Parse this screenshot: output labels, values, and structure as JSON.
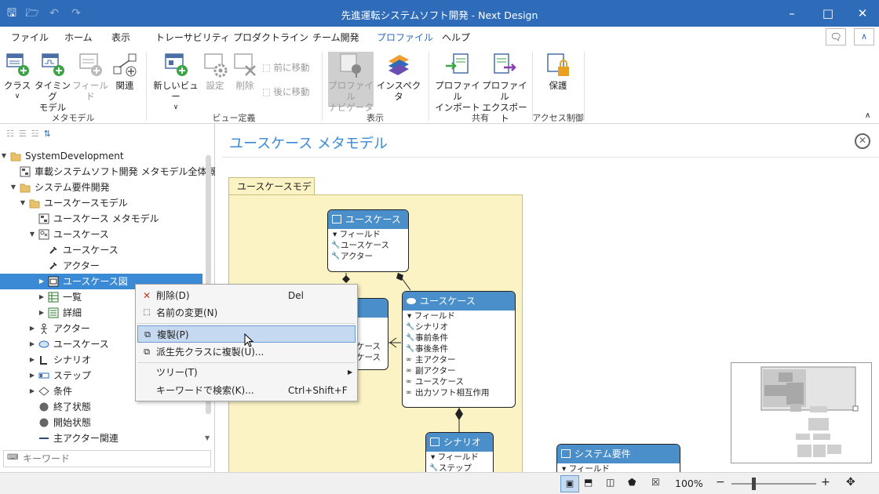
{
  "window": {
    "title": "先進運転システムソフト開発 - Next Design"
  },
  "menu": [
    "ファイル",
    "ホーム",
    "表示",
    "トレーサビリティ",
    "プロダクトライン",
    "チーム開発",
    "プロファイル",
    "ヘルプ"
  ],
  "ribbon": {
    "metamodel": {
      "class": "クラス",
      "timing": "タイミング",
      "timing2": "モデル",
      "field": "フィールド",
      "relation": "関連",
      "group": "メタモデル"
    },
    "viewdef": {
      "newview": "新しいビュー",
      "settings": "設定",
      "delete": "削除",
      "moveup": "前に移動",
      "movedown": "後に移動",
      "group": "ビュー定義"
    },
    "display": {
      "navigator": "プロファイル",
      "navigator2": "ナビゲータ",
      "inspector": "インスペクタ",
      "group": "表示"
    },
    "share": {
      "import": "プロファイル",
      "import2": "インポート",
      "export": "プロファイル",
      "export2": "エクスポート",
      "group": "共有"
    },
    "access": {
      "protect": "保護",
      "group": "アクセス制御"
    }
  },
  "tree": [
    {
      "label": "SystemDevelopment"
    },
    {
      "label": "車載システムソフト開発 メタモデル全体概要"
    },
    {
      "label": "システム要件開発"
    },
    {
      "label": "ユースケースモデル"
    },
    {
      "label": "ユースケース メタモデル"
    },
    {
      "label": "ユースケース"
    },
    {
      "label": "ユースケース"
    },
    {
      "label": "アクター"
    },
    {
      "label": "ユースケース図"
    },
    {
      "label": "一覧"
    },
    {
      "label": "詳細"
    },
    {
      "label": "アクター"
    },
    {
      "label": "ユースケース"
    },
    {
      "label": "シナリオ"
    },
    {
      "label": "ステップ"
    },
    {
      "label": "条件"
    },
    {
      "label": "終了状態"
    },
    {
      "label": "開始状態"
    },
    {
      "label": "主アクター関連"
    }
  ],
  "search": {
    "placeholder": "キーワード"
  },
  "editor": {
    "title": "ユースケース メタモデル",
    "package": "ユースケースモデル"
  },
  "nodes": {
    "usecase_top": {
      "title": "ユースケース",
      "field": "フィールド",
      "attrs": [
        "ユースケース",
        "アクター"
      ]
    },
    "usecase_main": {
      "title": "ユースケース",
      "field": "フィールド",
      "attrs": [
        "シナリオ",
        "事前条件",
        "事後条件",
        "主アクター",
        "副アクター",
        "ユースケース",
        "出力ソフト相互作用"
      ]
    },
    "partial": {
      "a1": "ケース",
      "a2": "ケース"
    },
    "scenario": {
      "title": "シナリオ",
      "field": "フィールド",
      "attr": "ステップ"
    },
    "sysreq": {
      "title": "システム要件",
      "field": "フィールド"
    }
  },
  "context_menu": [
    {
      "label": "削除(D)",
      "shortcut": "Del"
    },
    {
      "label": "名前の変更(N)",
      "shortcut": ""
    },
    {
      "label": "複製(P)",
      "shortcut": ""
    },
    {
      "label": "派生先クラスに複製(U)...",
      "shortcut": ""
    },
    {
      "label": "ツリー(T)",
      "shortcut": ""
    },
    {
      "label": "キーワードで検索(K)...",
      "shortcut": "Ctrl+Shift+F"
    }
  ],
  "status": {
    "zoom": "100%"
  }
}
